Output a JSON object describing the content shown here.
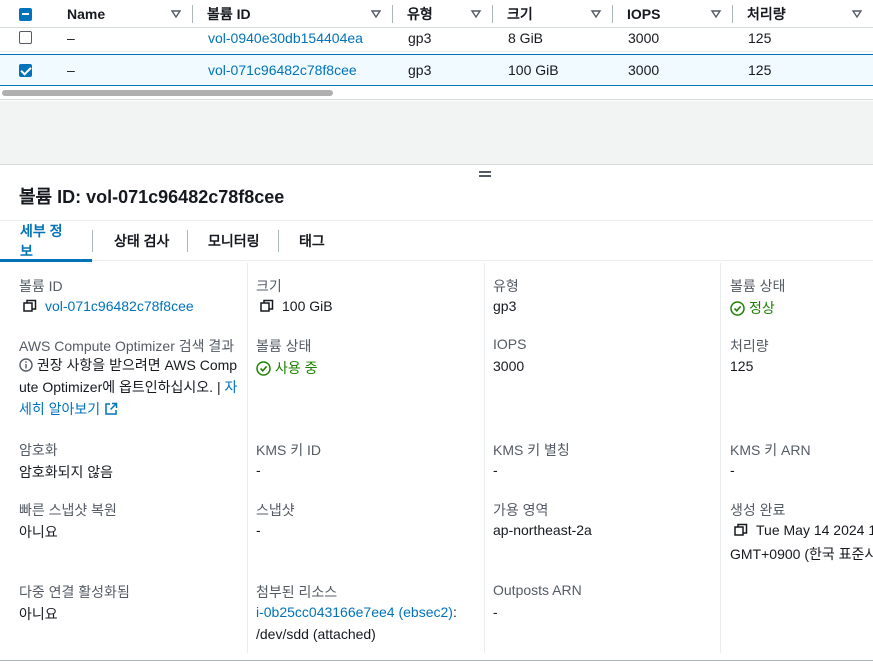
{
  "table": {
    "headers": [
      {
        "label": "Name"
      },
      {
        "label": "볼륨 ID"
      },
      {
        "label": "유형"
      },
      {
        "label": "크기"
      },
      {
        "label": "IOPS"
      },
      {
        "label": "처리량"
      }
    ],
    "rows": [
      {
        "name": "–",
        "volume_id": "vol-0940e30db154404ea",
        "type": "gp3",
        "size": "8 GiB",
        "iops": "3000",
        "throughput": "125",
        "selected": false
      },
      {
        "name": "–",
        "volume_id": "vol-071c96482c78f8cee",
        "type": "gp3",
        "size": "100 GiB",
        "iops": "3000",
        "throughput": "125",
        "selected": true
      }
    ]
  },
  "detail": {
    "title": "볼륨 ID: vol-071c96482c78f8cee",
    "tabs": [
      "세부 정보",
      "상태 검사",
      "모니터링",
      "태그"
    ],
    "active_tab": "세부 정보",
    "fields": {
      "volume_id_label": "볼륨 ID",
      "volume_id_value": "vol-071c96482c78f8cee",
      "size_label": "크기",
      "size_value": "100 GiB",
      "type_label": "유형",
      "type_value": "gp3",
      "volume_state_label": "볼륨 상태",
      "volume_state_value": "정상",
      "optimizer_label": "AWS Compute Optimizer 검색 결과",
      "optimizer_text": "권장 사항을 받으려면 AWS Compute Optimizer에 옵트인하십시오. |",
      "optimizer_link": "자세히 알아보기",
      "state_label": "볼륨 상태",
      "state_value": "사용 중",
      "iops_label": "IOPS",
      "iops_value": "3000",
      "throughput_label": "처리량",
      "throughput_value": "125",
      "encryption_label": "암호화",
      "encryption_value": "암호화되지 않음",
      "kms_id_label": "KMS 키 ID",
      "kms_id_value": "-",
      "kms_alias_label": "KMS 키 별칭",
      "kms_alias_value": "-",
      "kms_arn_label": "KMS 키 ARN",
      "kms_arn_value": "-",
      "fast_restore_label": "빠른 스냅샷 복원",
      "fast_restore_value": "아니요",
      "snapshot_label": "스냅샷",
      "snapshot_value": "-",
      "az_label": "가용 영역",
      "az_value": "ap-northeast-2a",
      "created_label": "생성 완료",
      "created_line1": "Tue May 14 2024 1",
      "created_line2": "GMT+0900 (한국 표준시",
      "multi_attach_label": "다중 연결 활성화됨",
      "multi_attach_value": "아니요",
      "attached_label": "첨부된 리소스",
      "attached_instance": "i-0b25cc043166e7ee4 (ebsec2)",
      "attached_colon": ":",
      "attached_device": "/dev/sdd (attached)",
      "outposts_label": "Outposts ARN",
      "outposts_value": "-"
    }
  },
  "colors": {
    "accent": "#0073bb",
    "success": "#1d8102",
    "text": "#16191f",
    "muted": "#545b64"
  }
}
